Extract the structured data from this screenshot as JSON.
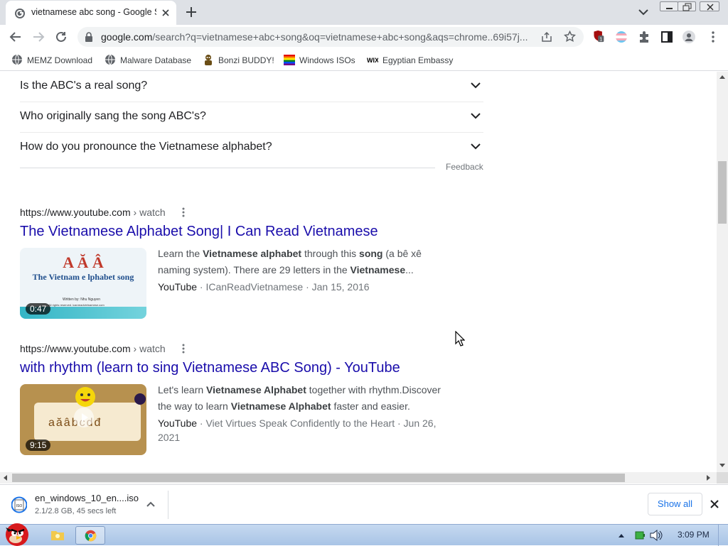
{
  "browser": {
    "tab_title": "vietnamese abc song - Google S",
    "url_host": "google.com",
    "url_rest": "/search?q=vietnamese+abc+song&oq=vietnamese+abc+song&aqs=chrome..69i57j...",
    "extension_badge": "1"
  },
  "bookmarks": [
    {
      "label": "MEMZ Download",
      "icon": "globe-icon"
    },
    {
      "label": "Malware Database",
      "icon": "globe-icon"
    },
    {
      "label": "Bonzi BUDDY!",
      "icon": "bonzi-icon"
    },
    {
      "label": "Windows ISOs",
      "icon": "windows-flag-icon"
    },
    {
      "label": "Egyptian Embassy",
      "icon": "wix-icon"
    }
  ],
  "faq": [
    "Is the ABC's a real song?",
    "Who originally sang the song ABC's?",
    "How do you pronounce the Vietnamese alphabet?"
  ],
  "feedback_label": "Feedback",
  "results": [
    {
      "site": "https://www.youtube.com",
      "crumb": " › watch",
      "title": "The Vietnamese Alphabet Song| I Can Read Vietnamese",
      "duration": "0:47",
      "thumb_heading": "A Ă Â",
      "thumb_text": "The Vietnam  e  lphabet song",
      "thumb_small1": "Written by:  Nhu Nguyen",
      "thumb_small2": "All rights reserved.  icanreadvietnamese.com",
      "snippet_html_parts": [
        {
          "t": "Learn the ",
          "b": false
        },
        {
          "t": "Vietnamese alphabet",
          "b": true
        },
        {
          "t": " through this ",
          "b": false
        },
        {
          "t": "song",
          "b": true
        },
        {
          "t": " (a bê xê naming system). There are 29 letters in the ",
          "b": false
        },
        {
          "t": "Vietnamese",
          "b": true
        },
        {
          "t": "...",
          "b": false
        }
      ],
      "source": "YouTube",
      "channel": " · ICanReadVietnamese · Jan 15, 2016"
    },
    {
      "site": "https://www.youtube.com",
      "crumb": " › watch",
      "title": "with rhythm (learn to sing Vietnamese ABC Song) - YouTube",
      "duration": "9:15",
      "thumb_text": "aăâbcdđ",
      "snippet_html_parts": [
        {
          "t": "Let's learn ",
          "b": false
        },
        {
          "t": "Vietnamese Alphabet",
          "b": true
        },
        {
          "t": " together with rhythm.Discover the way to learn ",
          "b": false
        },
        {
          "t": "Vietnamese Alphabet",
          "b": true
        },
        {
          "t": " faster and easier.",
          "b": false
        }
      ],
      "source": "YouTube",
      "channel": " · Viet Virtues Speak Confidently to the Heart · Jun 26, 2021"
    }
  ],
  "download": {
    "filename": "en_windows_10_en....iso",
    "progress": "2.1/2.8 GB, 45 secs left",
    "show_all": "Show all"
  },
  "taskbar": {
    "clock": "3:09 PM"
  },
  "colors": {
    "link": "#1a0dab",
    "accent": "#1a73e8",
    "tabstrip": "#dee1e6"
  }
}
